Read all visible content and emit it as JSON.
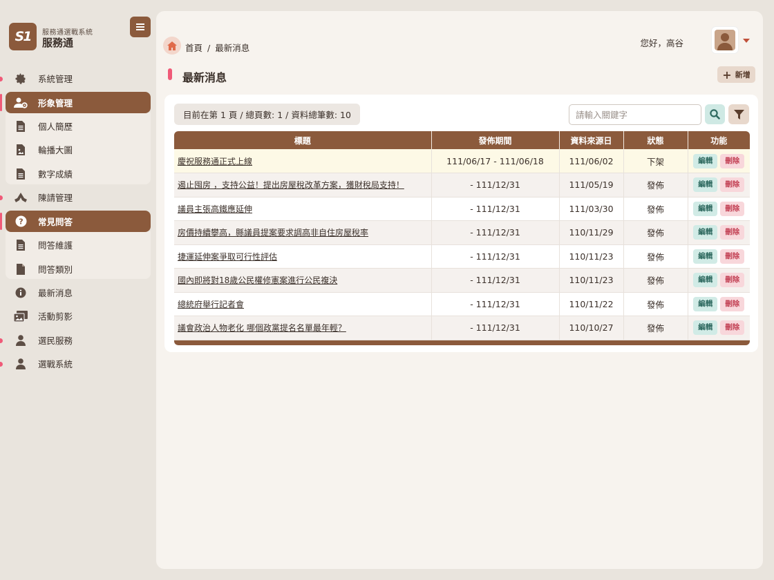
{
  "brand": {
    "logo_text": "S1",
    "subtitle": "服務通選戰系統",
    "name": "服務通"
  },
  "sidebar": {
    "toggle_icon": "hamburger-icon",
    "items": [
      {
        "label": "系統管理",
        "icon": "gear-icon"
      },
      {
        "label": "形象管理",
        "icon": "user-gear-icon"
      },
      {
        "label": "個人簡歷",
        "icon": "document-icon"
      },
      {
        "label": "輪播大圖",
        "icon": "image-file-icon"
      },
      {
        "label": "數字成績",
        "icon": "document-icon"
      },
      {
        "label": "陳請管理",
        "icon": "hands-icon"
      },
      {
        "label": "常見問答",
        "icon": "question-circle-icon"
      },
      {
        "label": "問答維護",
        "icon": "document-icon"
      },
      {
        "label": "問答類別",
        "icon": "file-icon"
      },
      {
        "label": "最新消息",
        "icon": "info-circle-icon"
      },
      {
        "label": "活動剪影",
        "icon": "photos-icon"
      },
      {
        "label": "選民服務",
        "icon": "user-icon"
      },
      {
        "label": "選戰系統",
        "icon": "user-icon"
      }
    ]
  },
  "header": {
    "breadcrumb_home": "首頁",
    "breadcrumb_sep": "/",
    "breadcrumb_current": "最新消息",
    "greeting": "您好，高谷"
  },
  "page": {
    "title": "最新消息",
    "add_label": "新增"
  },
  "toolbar": {
    "pager_text": "目前在第 1 頁 / 總頁數: 1 / 資料總筆數: 10",
    "search_placeholder": "請輸入關鍵字"
  },
  "table": {
    "columns": [
      "標題",
      "發佈期間",
      "資料來源日",
      "狀態",
      "功能"
    ],
    "edit_label": "編輯",
    "delete_label": "刪除",
    "rows": [
      {
        "title": "慶祝服務通正式上線",
        "period": "111/06/17 - 111/06/18",
        "source_date": "111/06/02",
        "status": "下架"
      },
      {
        "title": "遏止囤房 ，支持公益！提出房屋稅改革方案，獲財稅局支持！",
        "period": "- 111/12/31",
        "source_date": "111/05/19",
        "status": "發佈"
      },
      {
        "title": "議員主張高鐵應延伸",
        "period": "- 111/12/31",
        "source_date": "111/03/30",
        "status": "發佈"
      },
      {
        "title": "房價持續攀高，縣議員提案要求調高非自住房屋稅率",
        "period": "- 111/12/31",
        "source_date": "110/11/29",
        "status": "發佈"
      },
      {
        "title": "捷運延伸案爭取可行性評估",
        "period": "- 111/12/31",
        "source_date": "110/11/23",
        "status": "發佈"
      },
      {
        "title": "國內即將對18歲公民權修憲案進行公民複決",
        "period": "- 111/12/31",
        "source_date": "110/11/23",
        "status": "發佈"
      },
      {
        "title": "總統府舉行記者會",
        "period": "- 111/12/31",
        "source_date": "110/11/22",
        "status": "發佈"
      },
      {
        "title": "議會政治人物老化 哪個政黨提名名單最年輕？",
        "period": "- 111/12/31",
        "source_date": "110/10/27",
        "status": "發佈"
      }
    ]
  }
}
